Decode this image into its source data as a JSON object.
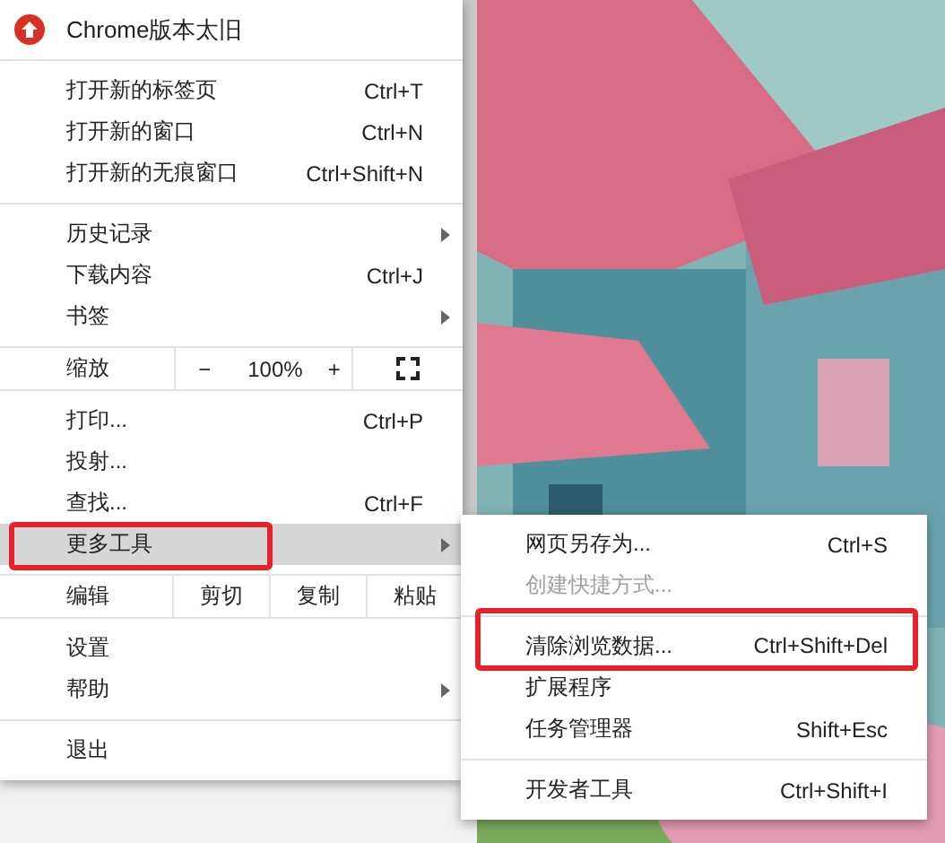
{
  "menu": {
    "header": {
      "label": "Chrome版本太旧"
    },
    "sections": [
      {
        "items": [
          {
            "kind": "item",
            "label": "打开新的标签页",
            "shortcut": "Ctrl+T"
          },
          {
            "kind": "item",
            "label": "打开新的窗口",
            "shortcut": "Ctrl+N"
          },
          {
            "kind": "item",
            "label": "打开新的无痕窗口",
            "shortcut": "Ctrl+Shift+N"
          }
        ]
      },
      {
        "items": [
          {
            "kind": "item",
            "label": "历史记录",
            "submenu": true
          },
          {
            "kind": "item",
            "label": "下载内容",
            "shortcut": "Ctrl+J"
          },
          {
            "kind": "item",
            "label": "书签",
            "submenu": true
          }
        ]
      },
      {
        "items": [
          {
            "kind": "zoom",
            "label": "缩放",
            "minus": "−",
            "value": "100%",
            "plus": "+"
          }
        ]
      },
      {
        "items": [
          {
            "kind": "item",
            "label": "打印...",
            "shortcut": "Ctrl+P"
          },
          {
            "kind": "item",
            "label": "投射..."
          },
          {
            "kind": "item",
            "label": "查找...",
            "shortcut": "Ctrl+F"
          },
          {
            "kind": "item",
            "label": "更多工具",
            "submenu": true,
            "selected": true,
            "annotated": true
          }
        ]
      },
      {
        "items": [
          {
            "kind": "edit",
            "label": "编辑",
            "actions": [
              "剪切",
              "复制",
              "粘贴"
            ]
          }
        ]
      },
      {
        "items": [
          {
            "kind": "item",
            "label": "设置"
          },
          {
            "kind": "item",
            "label": "帮助",
            "submenu": true
          }
        ]
      },
      {
        "items": [
          {
            "kind": "item",
            "label": "退出"
          }
        ]
      }
    ]
  },
  "submenu": {
    "sections": [
      {
        "items": [
          {
            "label": "网页另存为...",
            "shortcut": "Ctrl+S",
            "disabled": false
          },
          {
            "label": "创建快捷方式...",
            "disabled": true
          }
        ]
      },
      {
        "items": [
          {
            "label": "清除浏览数据...",
            "shortcut": "Ctrl+Shift+Del",
            "disabled": false,
            "annotated": true
          },
          {
            "label": "扩展程序",
            "disabled": false
          },
          {
            "label": "任务管理器",
            "shortcut": "Shift+Esc",
            "disabled": false
          }
        ]
      },
      {
        "items": [
          {
            "label": "开发者工具",
            "shortcut": "Ctrl+Shift+I",
            "disabled": false
          }
        ]
      }
    ]
  }
}
